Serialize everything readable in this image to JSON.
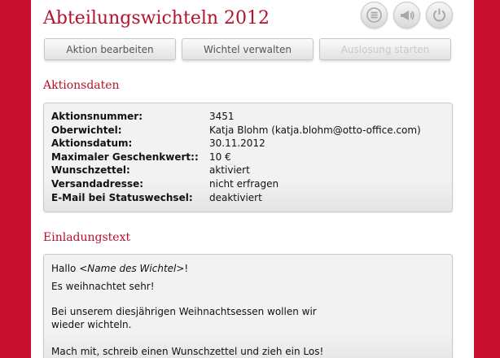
{
  "header": {
    "title": "Abteilungswichteln 2012",
    "icons": [
      "list-icon",
      "megaphone-icon",
      "power-icon"
    ]
  },
  "toolbar": {
    "edit_label": "Aktion bearbeiten",
    "manage_label": "Wichtel verwalten",
    "draw_label": "Auslosung starten",
    "draw_disabled": true
  },
  "action_data": {
    "heading": "Aktionsdaten",
    "rows": [
      {
        "label": "Aktionsnummer:",
        "value": "3451"
      },
      {
        "label": "Oberwichtel:",
        "value": "Katja Blohm (katja.blohm@otto-office.com)"
      },
      {
        "label": "Aktionsdatum:",
        "value": "30.11.2012"
      },
      {
        "label": "Maximaler Geschenkwert::",
        "value": "10 €"
      },
      {
        "label": "Wunschzettel:",
        "value": "aktiviert"
      },
      {
        "label": "Versandadresse:",
        "value": "nicht erfragen"
      },
      {
        "label": "E-Mail bei Statuswechsel:",
        "value": "deaktiviert"
      }
    ]
  },
  "invitation": {
    "heading": "Einladungstext",
    "greeting_prefix": "Hallo ",
    "greeting_placeholder": "<Name des Wichtel>",
    "greeting_suffix": "!",
    "line1": "Es weihnachtet sehr!",
    "line2a": "Bei unserem diesjährigen Weihnachtsessen wollen wir",
    "line2b": "wieder wichteln.",
    "line3": "Mach mit, schreib einen Wunschzettel und zieh ein Los!"
  },
  "colors": {
    "background": "#c8102e",
    "accent_text": "#b5122b",
    "panel": "#ffffff"
  }
}
